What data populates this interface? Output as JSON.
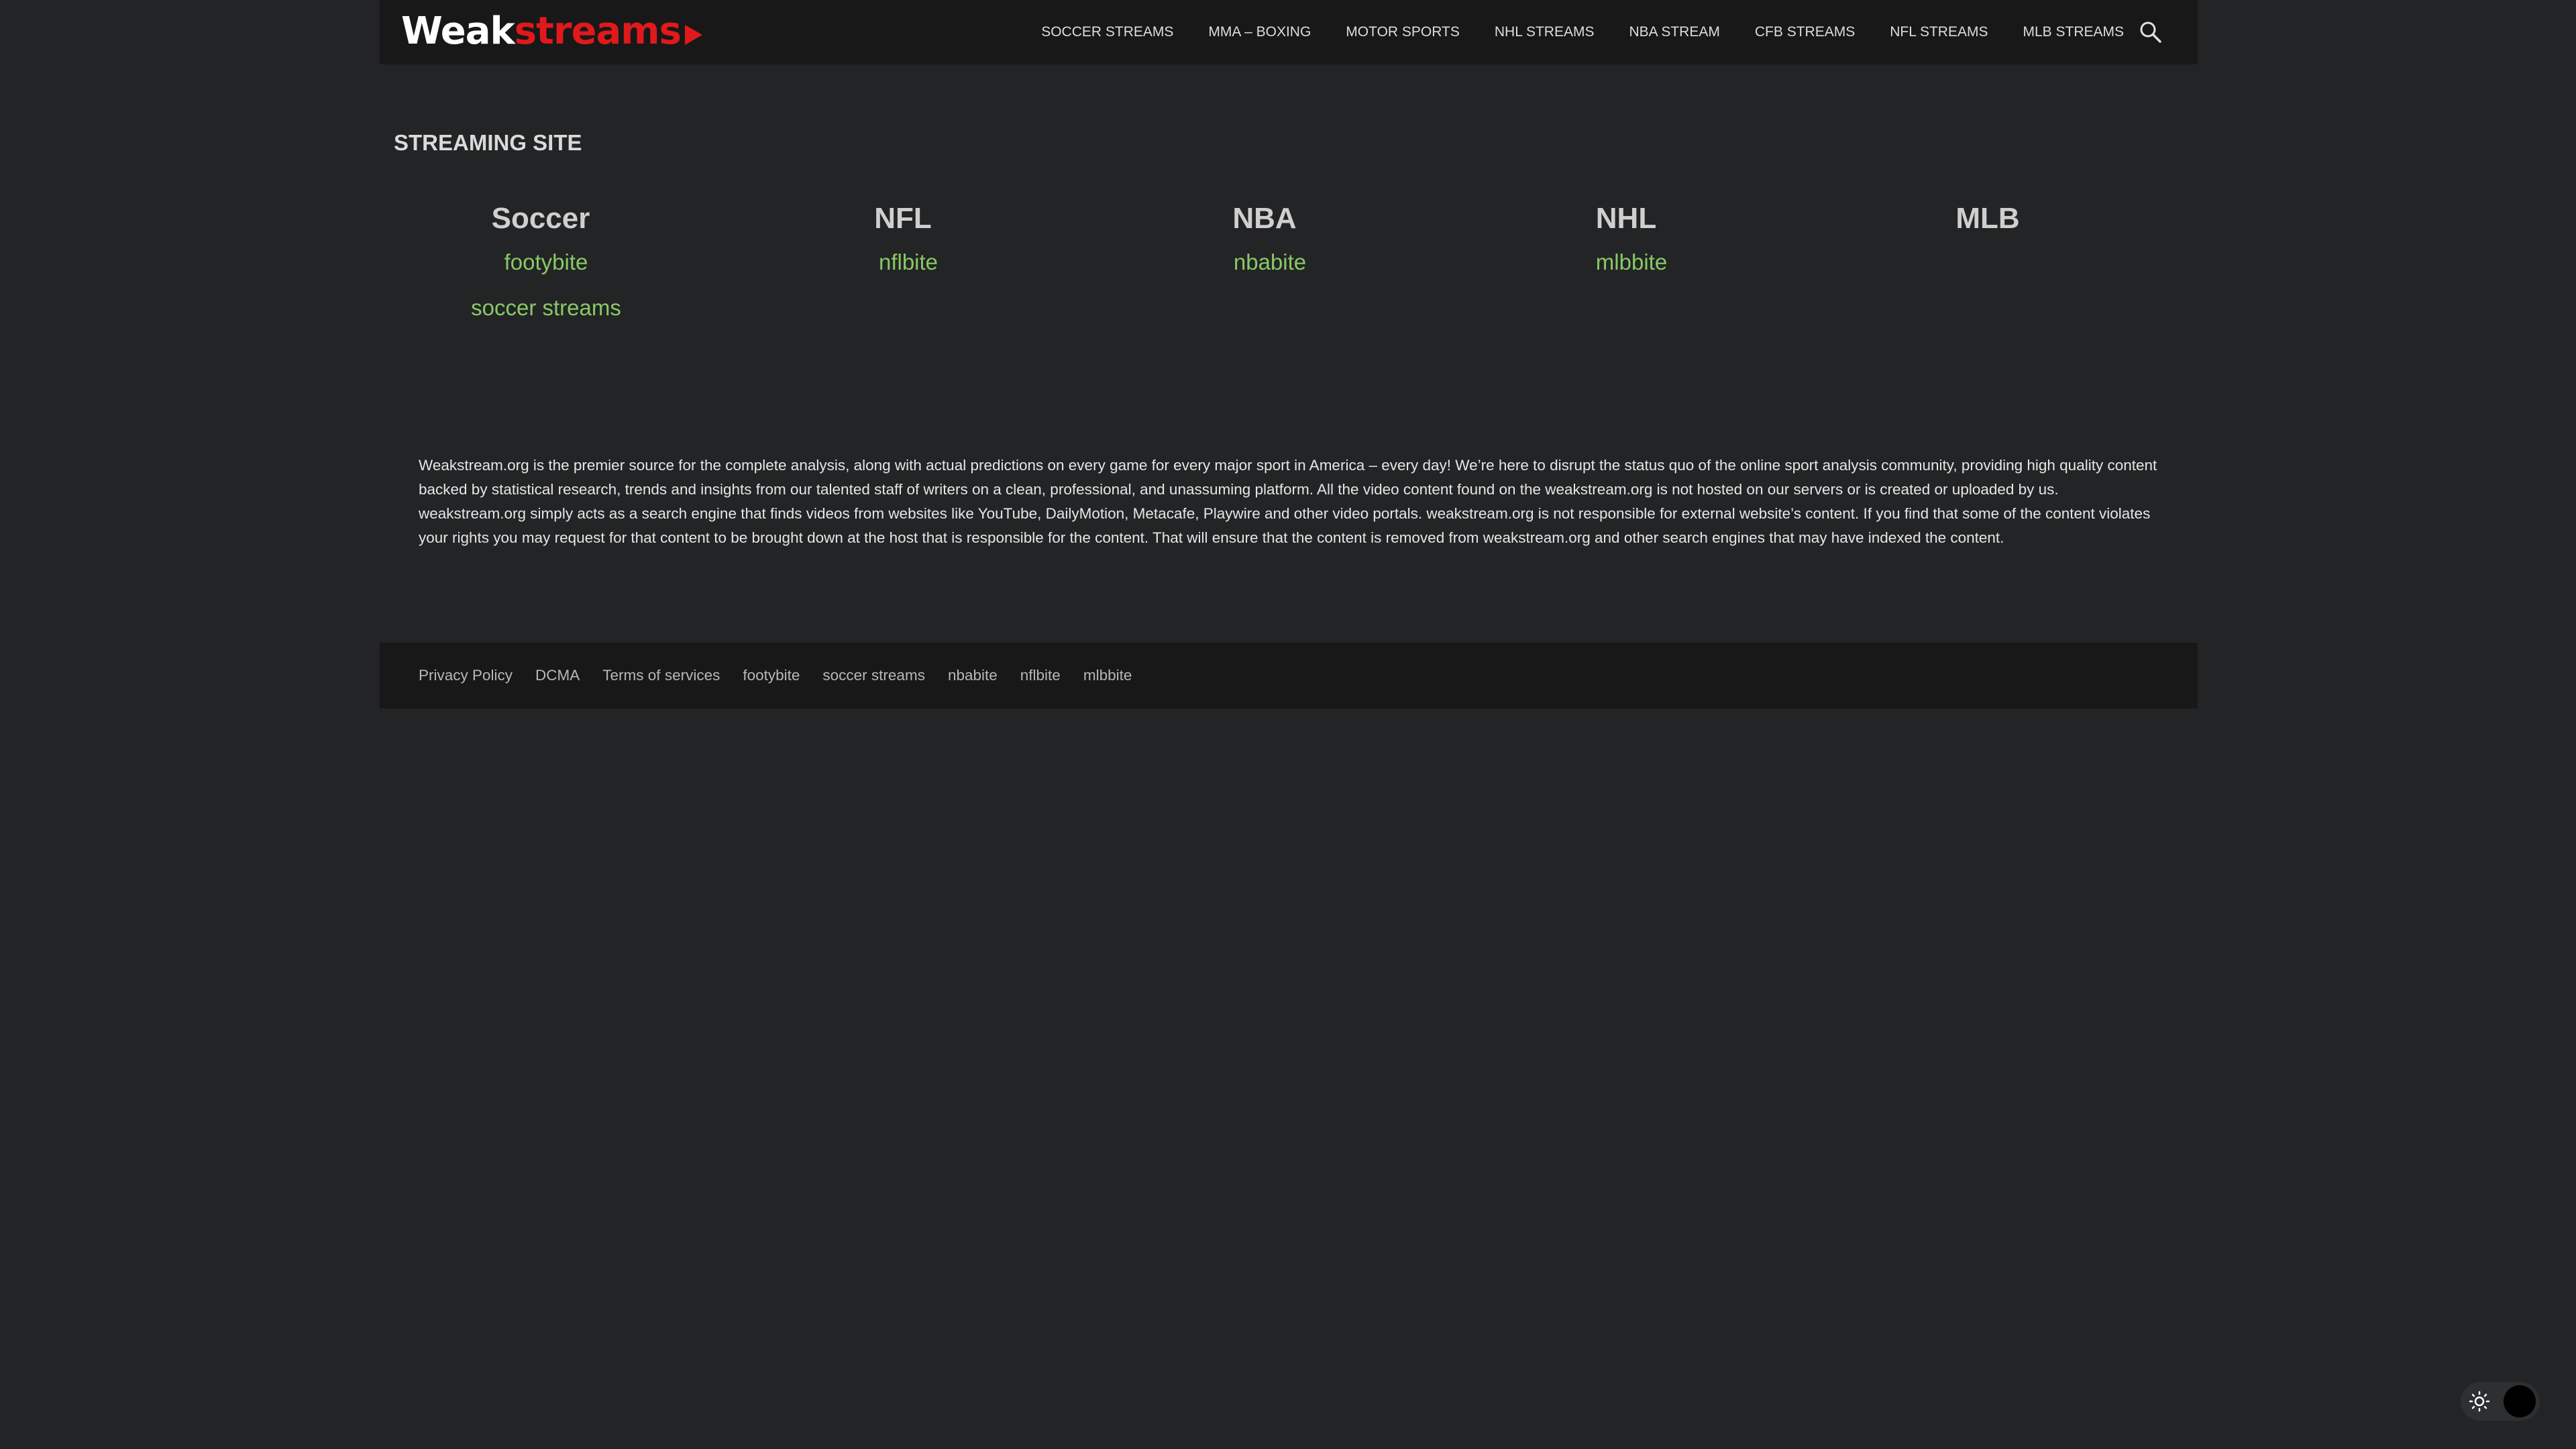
{
  "header": {
    "logo": {
      "part1": "Weak",
      "part2": "streams"
    },
    "nav": [
      "SOCCER STREAMS",
      "MMA – BOXING",
      "MOTOR SPORTS",
      "NHL STREAMS",
      "NBA STREAM",
      "CFB STREAMS",
      "NFL STREAMS",
      "MLB STREAMS"
    ],
    "search_icon": "search-icon"
  },
  "main": {
    "section_title": "STREAMING SITE",
    "sports": [
      {
        "title": "Soccer",
        "links": [
          "footybite",
          "soccer streams"
        ]
      },
      {
        "title": "NFL",
        "links": [
          "nflbite"
        ]
      },
      {
        "title": "NBA",
        "links": [
          "nbabite"
        ]
      },
      {
        "title": "NHL",
        "links": [
          "mlbbite"
        ]
      },
      {
        "title": "MLB",
        "links": []
      }
    ],
    "about": "Weakstream.org is the premier source for the complete analysis, along with actual predictions on every game for every major sport in America – every day! We’re here to disrupt the status quo of the online sport analysis community, providing high quality content backed by statistical research, trends and insights from our talented staff of writers on a clean, professional, and unassuming platform. All the video content found on the weakstream.org is not hosted on our servers or is created or uploaded by us. weakstream.org simply acts as a search engine that finds videos from websites like YouTube, DailyMotion, Metacafe, Playwire and other video portals. weakstream.org is not responsible for external website’s content. If you find that some of the content violates your rights you may request for that content to be brought down at the host that is responsible for the content. That will ensure that the content is removed from weakstream.org and other search engines that may have indexed the content."
  },
  "footer": {
    "links": [
      "Privacy Policy",
      "DCMA",
      "Terms of services",
      "footybite",
      "soccer streams",
      "nbabite",
      "nflbite",
      "mlbbite"
    ]
  },
  "theme_toggle": {
    "light_icon": "sun-icon",
    "dark_icon": "moon-icon",
    "mode": "dark"
  },
  "colors": {
    "background": "#232425",
    "header_bg": "#181818",
    "link_green": "#88c966",
    "logo_red": "#e0191b"
  }
}
